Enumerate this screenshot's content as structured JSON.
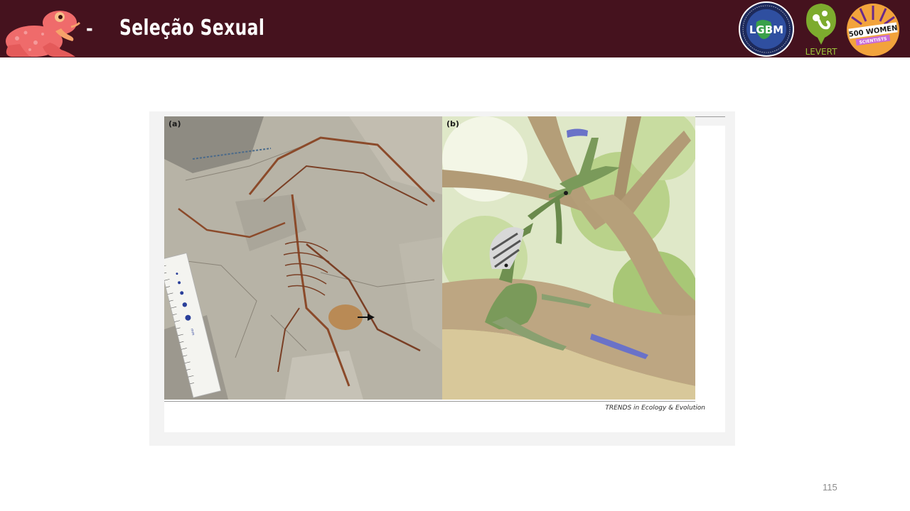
{
  "header": {
    "dash": "-",
    "title": "Seleção Sexual",
    "logos": {
      "lgbm": "LGBM",
      "lgbm_ring": "EVOLUÇÃO, ECOLOGIA E GENÉTICA DA CONSERVAÇÃO",
      "levert": "LEVERT",
      "women_top": "500 WOMEN",
      "women_bottom": "SCIENTISTS"
    },
    "colors": {
      "bar": "#45121e",
      "frog": "#ef6b6b"
    }
  },
  "figure": {
    "panel_a_label": "(a)",
    "panel_b_label": "(b)",
    "scale_label": "mm",
    "credit": "TRENDS in Ecology & Evolution"
  },
  "footer": {
    "page_number": "115"
  }
}
